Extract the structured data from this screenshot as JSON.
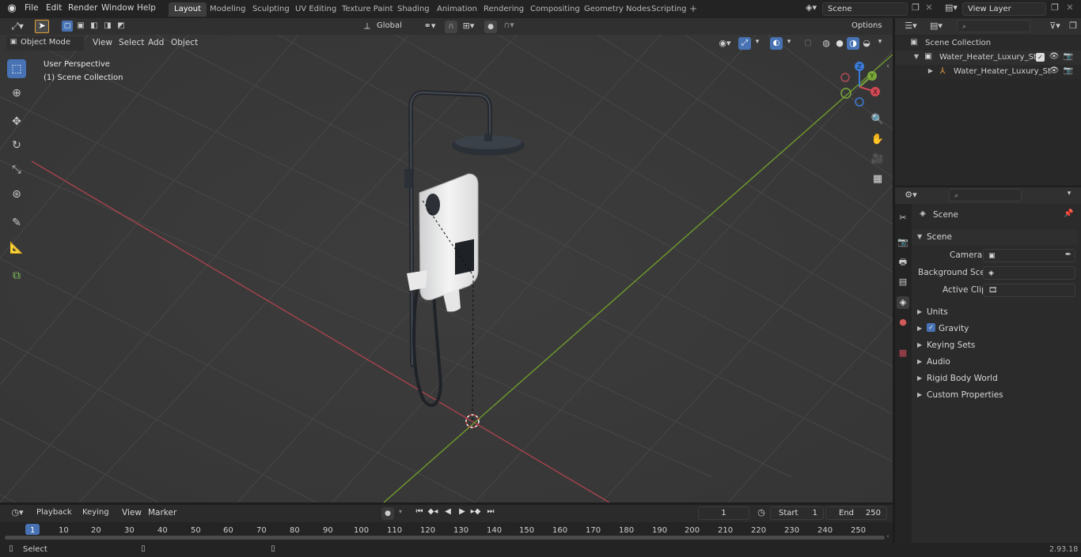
{
  "app": {
    "menu": [
      "File",
      "Edit",
      "Render",
      "Window",
      "Help"
    ],
    "workspaces": [
      "Layout",
      "Modeling",
      "Sculpting",
      "UV Editing",
      "Texture Paint",
      "Shading",
      "Animation",
      "Rendering",
      "Compositing",
      "Geometry Nodes",
      "Scripting"
    ],
    "active_workspace": "Layout",
    "scene_name": "Scene",
    "view_layer": "View Layer",
    "version": "2.93.18"
  },
  "viewport": {
    "mode": "Object Mode",
    "menus": [
      "View",
      "Select",
      "Add",
      "Object"
    ],
    "transform_orientation": "Global",
    "options_label": "Options",
    "perspective_label": "User Perspective",
    "collection_label": "(1) Scene Collection",
    "gizmo_axes": [
      "Z",
      "Y",
      "X"
    ]
  },
  "outliner": {
    "root": "Scene Collection",
    "items": [
      {
        "label": "Water_Heater_Luxury_Style_(",
        "kind": "collection"
      },
      {
        "label": "Water_Heater_Luxury_St",
        "kind": "object"
      }
    ]
  },
  "properties": {
    "context_title": "Scene",
    "panel_title": "Scene",
    "fields": [
      {
        "label": "Camera"
      },
      {
        "label": "Background Scene"
      },
      {
        "label": "Active Clip"
      }
    ],
    "subpanels": [
      "Units",
      "Gravity",
      "Keying Sets",
      "Audio",
      "Rigid Body World",
      "Custom Properties"
    ],
    "gravity_checked": true
  },
  "timeline": {
    "menus": [
      "Playback",
      "Keying",
      "View",
      "Marker"
    ],
    "current_frame": "1",
    "start_label": "Start",
    "start_value": "1",
    "end_label": "End",
    "end_value": "250",
    "ruler": [
      "1",
      "10",
      "20",
      "30",
      "40",
      "50",
      "60",
      "70",
      "80",
      "90",
      "100",
      "110",
      "120",
      "130",
      "140",
      "150",
      "160",
      "170",
      "180",
      "190",
      "200",
      "210",
      "220",
      "230",
      "240",
      "250"
    ]
  },
  "status": {
    "select_label": "Select"
  }
}
